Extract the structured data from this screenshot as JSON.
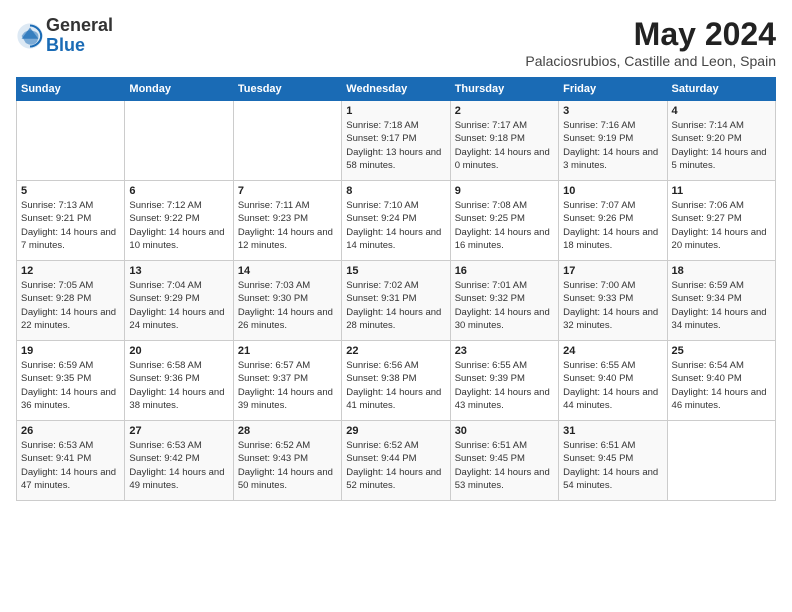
{
  "header": {
    "logo_general": "General",
    "logo_blue": "Blue",
    "month": "May 2024",
    "location": "Palaciosrubios, Castille and Leon, Spain"
  },
  "days_of_week": [
    "Sunday",
    "Monday",
    "Tuesday",
    "Wednesday",
    "Thursday",
    "Friday",
    "Saturday"
  ],
  "weeks": [
    [
      {
        "day": "",
        "info": ""
      },
      {
        "day": "",
        "info": ""
      },
      {
        "day": "",
        "info": ""
      },
      {
        "day": "1",
        "info": "Sunrise: 7:18 AM\nSunset: 9:17 PM\nDaylight: 13 hours and 58 minutes."
      },
      {
        "day": "2",
        "info": "Sunrise: 7:17 AM\nSunset: 9:18 PM\nDaylight: 14 hours and 0 minutes."
      },
      {
        "day": "3",
        "info": "Sunrise: 7:16 AM\nSunset: 9:19 PM\nDaylight: 14 hours and 3 minutes."
      },
      {
        "day": "4",
        "info": "Sunrise: 7:14 AM\nSunset: 9:20 PM\nDaylight: 14 hours and 5 minutes."
      }
    ],
    [
      {
        "day": "5",
        "info": "Sunrise: 7:13 AM\nSunset: 9:21 PM\nDaylight: 14 hours and 7 minutes."
      },
      {
        "day": "6",
        "info": "Sunrise: 7:12 AM\nSunset: 9:22 PM\nDaylight: 14 hours and 10 minutes."
      },
      {
        "day": "7",
        "info": "Sunrise: 7:11 AM\nSunset: 9:23 PM\nDaylight: 14 hours and 12 minutes."
      },
      {
        "day": "8",
        "info": "Sunrise: 7:10 AM\nSunset: 9:24 PM\nDaylight: 14 hours and 14 minutes."
      },
      {
        "day": "9",
        "info": "Sunrise: 7:08 AM\nSunset: 9:25 PM\nDaylight: 14 hours and 16 minutes."
      },
      {
        "day": "10",
        "info": "Sunrise: 7:07 AM\nSunset: 9:26 PM\nDaylight: 14 hours and 18 minutes."
      },
      {
        "day": "11",
        "info": "Sunrise: 7:06 AM\nSunset: 9:27 PM\nDaylight: 14 hours and 20 minutes."
      }
    ],
    [
      {
        "day": "12",
        "info": "Sunrise: 7:05 AM\nSunset: 9:28 PM\nDaylight: 14 hours and 22 minutes."
      },
      {
        "day": "13",
        "info": "Sunrise: 7:04 AM\nSunset: 9:29 PM\nDaylight: 14 hours and 24 minutes."
      },
      {
        "day": "14",
        "info": "Sunrise: 7:03 AM\nSunset: 9:30 PM\nDaylight: 14 hours and 26 minutes."
      },
      {
        "day": "15",
        "info": "Sunrise: 7:02 AM\nSunset: 9:31 PM\nDaylight: 14 hours and 28 minutes."
      },
      {
        "day": "16",
        "info": "Sunrise: 7:01 AM\nSunset: 9:32 PM\nDaylight: 14 hours and 30 minutes."
      },
      {
        "day": "17",
        "info": "Sunrise: 7:00 AM\nSunset: 9:33 PM\nDaylight: 14 hours and 32 minutes."
      },
      {
        "day": "18",
        "info": "Sunrise: 6:59 AM\nSunset: 9:34 PM\nDaylight: 14 hours and 34 minutes."
      }
    ],
    [
      {
        "day": "19",
        "info": "Sunrise: 6:59 AM\nSunset: 9:35 PM\nDaylight: 14 hours and 36 minutes."
      },
      {
        "day": "20",
        "info": "Sunrise: 6:58 AM\nSunset: 9:36 PM\nDaylight: 14 hours and 38 minutes."
      },
      {
        "day": "21",
        "info": "Sunrise: 6:57 AM\nSunset: 9:37 PM\nDaylight: 14 hours and 39 minutes."
      },
      {
        "day": "22",
        "info": "Sunrise: 6:56 AM\nSunset: 9:38 PM\nDaylight: 14 hours and 41 minutes."
      },
      {
        "day": "23",
        "info": "Sunrise: 6:55 AM\nSunset: 9:39 PM\nDaylight: 14 hours and 43 minutes."
      },
      {
        "day": "24",
        "info": "Sunrise: 6:55 AM\nSunset: 9:40 PM\nDaylight: 14 hours and 44 minutes."
      },
      {
        "day": "25",
        "info": "Sunrise: 6:54 AM\nSunset: 9:40 PM\nDaylight: 14 hours and 46 minutes."
      }
    ],
    [
      {
        "day": "26",
        "info": "Sunrise: 6:53 AM\nSunset: 9:41 PM\nDaylight: 14 hours and 47 minutes."
      },
      {
        "day": "27",
        "info": "Sunrise: 6:53 AM\nSunset: 9:42 PM\nDaylight: 14 hours and 49 minutes."
      },
      {
        "day": "28",
        "info": "Sunrise: 6:52 AM\nSunset: 9:43 PM\nDaylight: 14 hours and 50 minutes."
      },
      {
        "day": "29",
        "info": "Sunrise: 6:52 AM\nSunset: 9:44 PM\nDaylight: 14 hours and 52 minutes."
      },
      {
        "day": "30",
        "info": "Sunrise: 6:51 AM\nSunset: 9:45 PM\nDaylight: 14 hours and 53 minutes."
      },
      {
        "day": "31",
        "info": "Sunrise: 6:51 AM\nSunset: 9:45 PM\nDaylight: 14 hours and 54 minutes."
      },
      {
        "day": "",
        "info": ""
      }
    ]
  ]
}
